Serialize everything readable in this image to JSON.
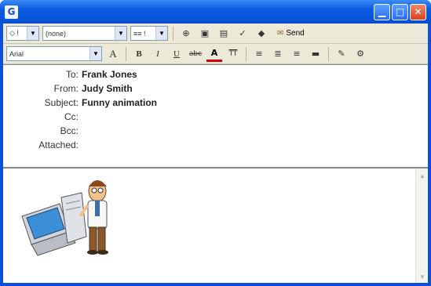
{
  "titlebar": {
    "app_icon_glyph": "G"
  },
  "window_controls": {
    "minimize": "▁",
    "maximize": "□",
    "close": "✕"
  },
  "toolbar1": {
    "priority_value": "◇ !",
    "signature_value": "(none)",
    "format_value": "≡≡ !",
    "send_label": "Send"
  },
  "toolbar2": {
    "font_value": "Arial",
    "font_size_label": "A",
    "bold": "B",
    "italic": "I",
    "underline": "U",
    "strike": "abc",
    "color": "A",
    "small_caps": "TT"
  },
  "header": {
    "fields": [
      {
        "label": "To:",
        "value": "Frank Jones"
      },
      {
        "label": "From:",
        "value": "Judy Smith"
      },
      {
        "label": "Subject:",
        "value": "Funny animation"
      },
      {
        "label": "Cc:",
        "value": ""
      },
      {
        "label": "Bcc:",
        "value": ""
      },
      {
        "label": "Attached:",
        "value": ""
      }
    ]
  },
  "colors": {
    "title_blue": "#0a50d8",
    "chrome": "#ece9d8",
    "close_red": "#d8401c"
  },
  "icons": [
    "app-icon",
    "find-icon",
    "paste-icon",
    "address-book-icon",
    "check-names-icon",
    "spell-check-icon",
    "send-icon",
    "align-left-icon",
    "align-center-icon",
    "align-right-icon",
    "rule-icon",
    "spell-icon",
    "format-icon"
  ]
}
